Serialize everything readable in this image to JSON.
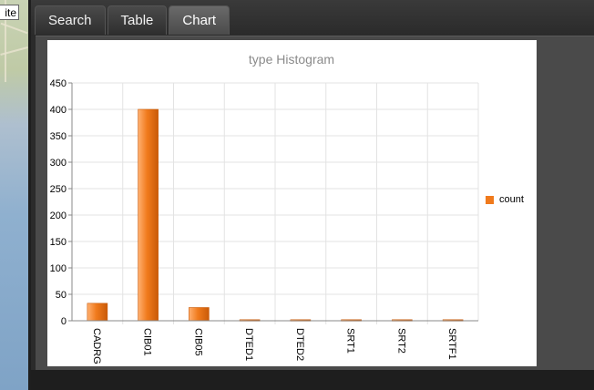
{
  "map": {
    "label": "ite"
  },
  "tabs": [
    {
      "label": "Search",
      "active": false
    },
    {
      "label": "Table",
      "active": false
    },
    {
      "label": "Chart",
      "active": true
    }
  ],
  "colors": {
    "bar": "#f07a1c",
    "barDark": "#c95a08",
    "barLight": "#ffb070"
  },
  "chart_data": {
    "type": "bar",
    "title": "type Histogram",
    "categories": [
      "CADRG",
      "CIB01",
      "CIB05",
      "DTED1",
      "DTED2",
      "SRT1",
      "SRT2",
      "SRTF1"
    ],
    "series": [
      {
        "name": "count",
        "values": [
          33,
          400,
          25,
          2,
          2,
          2,
          2,
          2
        ]
      }
    ],
    "ylim": [
      0,
      450
    ],
    "yticks": [
      0,
      50,
      100,
      150,
      200,
      250,
      300,
      350,
      400,
      450
    ],
    "grid": true,
    "legend_position": "right"
  }
}
